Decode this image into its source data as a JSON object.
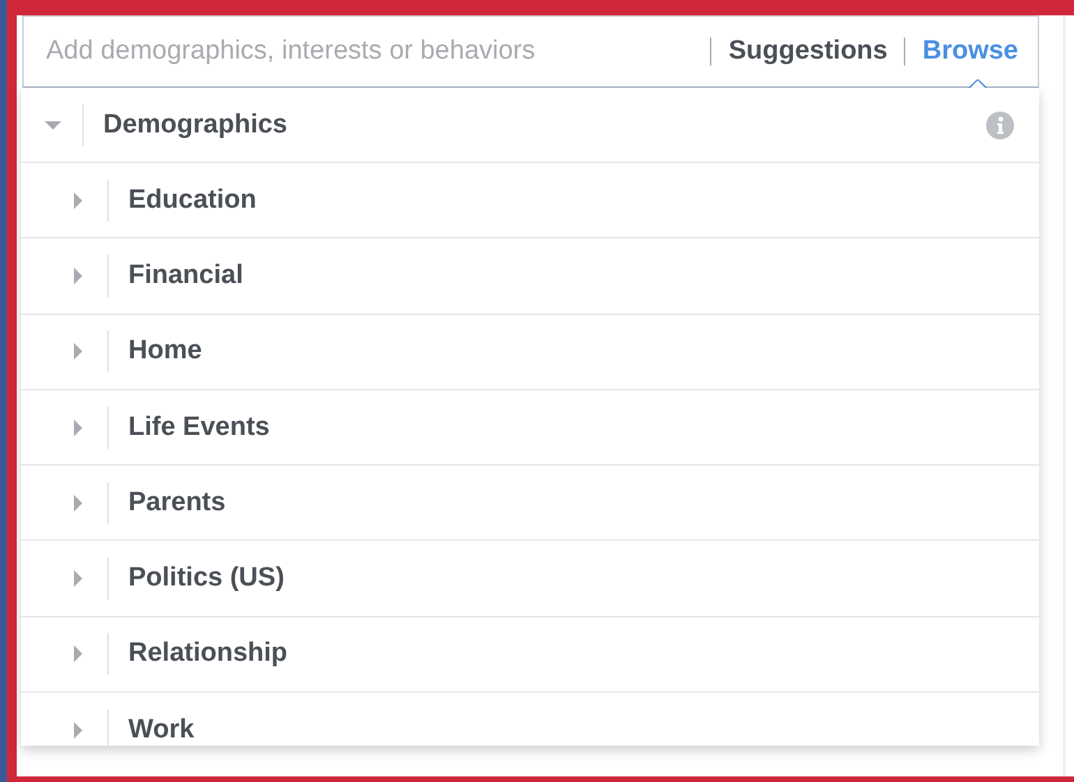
{
  "search": {
    "placeholder": "Add demographics, interests or behaviors"
  },
  "tabs": [
    {
      "label": "Suggestions",
      "selected": false
    },
    {
      "label": "Browse",
      "selected": true
    }
  ],
  "category": {
    "label": "Demographics",
    "expanded": true,
    "children": [
      {
        "label": "Education",
        "expanded": false
      },
      {
        "label": "Financial",
        "expanded": false
      },
      {
        "label": "Home",
        "expanded": false
      },
      {
        "label": "Life Events",
        "expanded": false
      },
      {
        "label": "Parents",
        "expanded": false
      },
      {
        "label": "Politics (US)",
        "expanded": false
      },
      {
        "label": "Relationship",
        "expanded": false
      },
      {
        "label": "Work",
        "expanded": false
      }
    ]
  }
}
